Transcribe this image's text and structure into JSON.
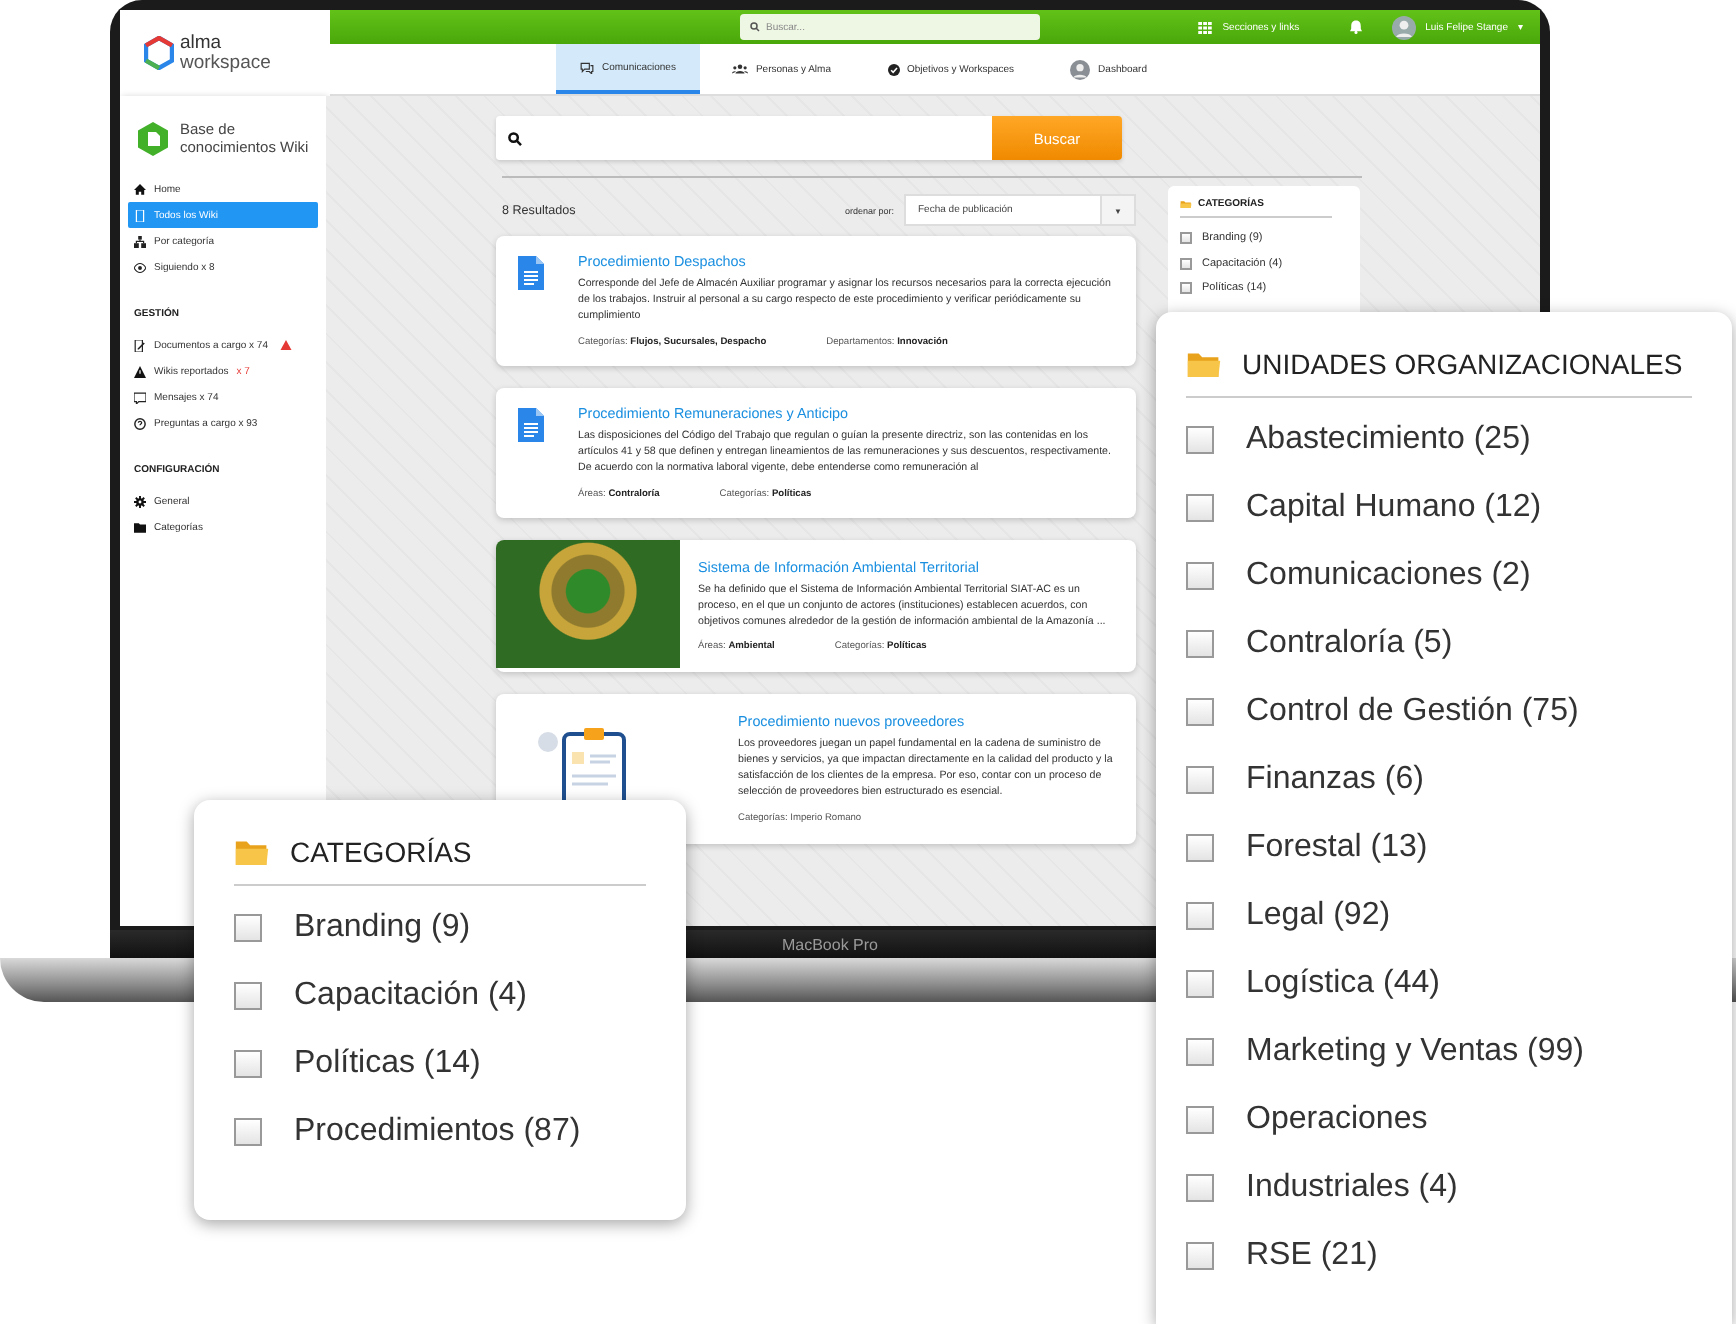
{
  "topbar": {
    "logo": {
      "line1": "alma",
      "line2": "workspace"
    },
    "search": {
      "placeholder": "Buscar..."
    },
    "links": "Secciones y links",
    "user": {
      "name": "Luis Felipe Stange",
      "caret": "▾"
    }
  },
  "nav": {
    "tabs": [
      {
        "label": "Comunicaciones",
        "selected": true
      },
      {
        "label": "Personas y Alma",
        "selected": false
      },
      {
        "label": "Objetivos y Workspaces",
        "selected": false
      },
      {
        "label": "Dashboard",
        "selected": false
      }
    ]
  },
  "sidebar": {
    "title": "Base de conocimientos Wiki",
    "sections": [
      {
        "items": [
          {
            "label": "Home",
            "selected": false
          },
          {
            "label": "Todos los Wiki",
            "selected": true
          },
          {
            "label": "Por categoría",
            "selected": false
          },
          {
            "label": "Siguiendo x 8",
            "selected": false
          }
        ]
      },
      {
        "heading": "GESTIÓN",
        "items": [
          {
            "label": "Documentos a cargo x 74",
            "selected": false,
            "warning": true
          },
          {
            "label": "Wikis reportados",
            "count": "x 7",
            "selected": false,
            "warning": false
          },
          {
            "label": "Mensajes x 74",
            "selected": false,
            "warning": false
          },
          {
            "label": "Preguntas a cargo x 93",
            "selected": false,
            "warning": false
          }
        ]
      },
      {
        "heading": "CONFIGURACIÓN",
        "items": [
          {
            "label": "General",
            "selected": false
          },
          {
            "label": "Categorías",
            "selected": false
          }
        ]
      }
    ]
  },
  "search": {
    "button": "Buscar"
  },
  "results": {
    "count": "8 Resultados",
    "sort_label": "ordenar por:",
    "sort_value": "Fecha de publicación",
    "sort_caret": "▼",
    "cards": [
      {
        "kind": "document",
        "title": "Procedimiento Despachos",
        "description": "Corresponde del Jefe de Almacén Auxiliar programar y asignar los recursos necesarios para la correcta ejecución de los trabajos. Instruir al personal a su cargo respecto de este procedimiento y verificar periódicamente su cumplimiento",
        "meta": [
          "Categorías: **Flujos, Sucursales, Despacho**",
          "Departamentos: **Innovación**"
        ]
      },
      {
        "kind": "document",
        "title": "Procedimiento Remuneraciones y Anticipo",
        "description": "Las disposiciones del Código del Trabajo que regulan o guían la presente directriz, son las contenidas en los artículos 41 y 58 que definen y entregan lineamientos de las remuneraciones y sus descuentos, respectivamente. De acuerdo con la normativa laboral vigente, debe entenderse como remuneración al",
        "meta": [
          "Áreas: **Contraloría**",
          "Categorías: **Políticas**"
        ]
      },
      {
        "kind": "photo",
        "title": "Sistema de Información Ambiental Territorial",
        "description": "Se ha definido que el Sistema de Información Ambiental Territorial SIAT-AC es un proceso, en el que un conjunto de actores (instituciones) establecen acuerdos, con objetivos comunes alrededor de la gestión de información ambiental de la Amazonía ...",
        "meta": [
          "Áreas: **Ambiental**",
          "Categorías: **Políticas**"
        ]
      },
      {
        "kind": "illustration",
        "title": "Procedimiento nuevos proveedores",
        "description": "Los proveedores juegan un papel fundamental en la cadena de suministro de bienes y servicios, ya que impactan directamente en la calidad del producto y la satisfacción de los clientes de la empresa. Por eso, contar con un proceso de selección de proveedores bien estructurado es esencial.",
        "meta": [
          "Categorías: Imperio Romano"
        ]
      }
    ]
  },
  "side_filter": {
    "title": "CATEGORÍAS",
    "items": [
      {
        "label": "Branding (9)",
        "checked": false
      },
      {
        "label": "Capacitación (4)",
        "checked": false
      },
      {
        "label": "Políticas (14)",
        "checked": false
      }
    ]
  },
  "device_label": "MacBook Pro",
  "categories_card": {
    "title": "CATEGORÍAS",
    "items": [
      {
        "label": "Branding (9)",
        "checked": false
      },
      {
        "label": "Capacitación (4)",
        "checked": false
      },
      {
        "label": "Políticas (14)",
        "checked": false
      },
      {
        "label": "Procedimientos (87)",
        "checked": false
      }
    ]
  },
  "units_card": {
    "title": "UNIDADES ORGANIZACIONALES",
    "items": [
      {
        "label": "Abastecimiento (25)",
        "checked": false
      },
      {
        "label": "Capital Humano (12)",
        "checked": false
      },
      {
        "label": "Comunicaciones (2)",
        "checked": false
      },
      {
        "label": "Contraloría (5)",
        "checked": false
      },
      {
        "label": "Control de Gestión (75)",
        "checked": false
      },
      {
        "label": "Finanzas (6)",
        "checked": false
      },
      {
        "label": "Forestal (13)",
        "checked": false
      },
      {
        "label": "Legal (92)",
        "checked": false
      },
      {
        "label": "Logística (44)",
        "checked": false
      },
      {
        "label": "Marketing y Ventas (99)",
        "checked": false
      },
      {
        "label": "Operaciones",
        "checked": false
      },
      {
        "label": "Industriales (4)",
        "checked": false
      },
      {
        "label": "RSE (21)",
        "checked": false
      }
    ]
  }
}
